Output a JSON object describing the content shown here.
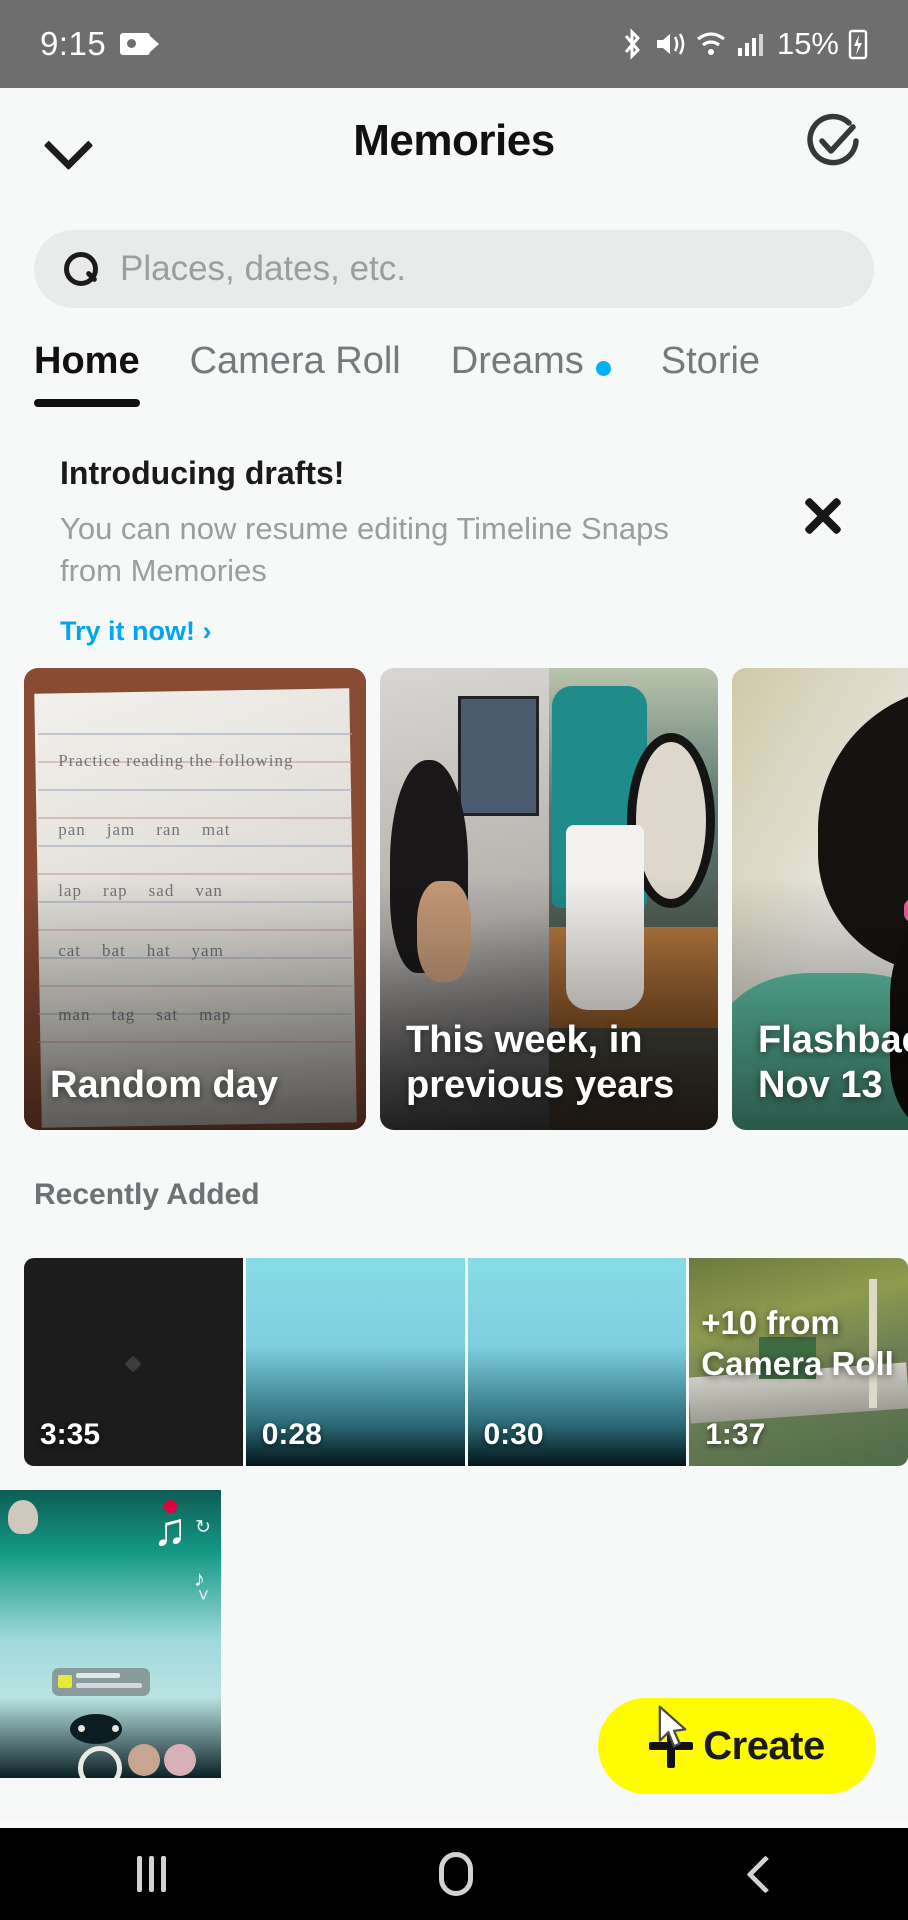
{
  "status_bar": {
    "time": "9:15",
    "recording_icon": "video-camera-icon",
    "bluetooth_icon": "bluetooth-icon",
    "mute_icon": "volume-mute-icon",
    "wifi_icon": "wifi-icon",
    "signal_icon": "cellular-signal-icon",
    "battery_percent": "15%",
    "battery_icon": "battery-charging-icon"
  },
  "header": {
    "back_icon": "chevron-down-icon",
    "title": "Memories",
    "select_icon": "circle-check-icon"
  },
  "search": {
    "icon": "search-icon",
    "placeholder": "Places, dates, etc.",
    "value": ""
  },
  "tabs": [
    {
      "label": "Home",
      "active": true,
      "dot": false
    },
    {
      "label": "Camera Roll",
      "active": false,
      "dot": false
    },
    {
      "label": "Dreams",
      "active": false,
      "dot": true
    },
    {
      "label": "Storie",
      "active": false,
      "dot": false
    }
  ],
  "banner": {
    "title": "Introducing drafts!",
    "description": "You can now resume editing Timeline Snaps from Memories",
    "cta": "Try it now!",
    "cta_arrow": "›",
    "close_icon": "close-icon"
  },
  "highlight_cards": [
    {
      "label": "Random day"
    },
    {
      "label": "This week, in previous years"
    },
    {
      "label": "Flashbac"
    },
    {
      "label": "Nov 13"
    }
  ],
  "recently_added": {
    "section_title": "Recently Added",
    "thumbnails": [
      {
        "duration": "3:35",
        "overlay": ""
      },
      {
        "duration": "0:28",
        "overlay": ""
      },
      {
        "duration": "0:30",
        "overlay": ""
      },
      {
        "duration": "1:37",
        "overlay": "+10 from Camera Roll"
      }
    ]
  },
  "create_button": {
    "label": "Create",
    "plus_icon": "plus-icon",
    "cursor_icon": "mouse-cursor-icon",
    "color": "#fffc00"
  },
  "nav_bar": {
    "recents_icon": "recents-icon",
    "home_icon": "home-icon",
    "back_icon": "back-chevron-icon"
  },
  "colors": {
    "accent_blue": "#00a5ef",
    "tab_dot": "#00b0f5",
    "snapchat_yellow": "#fffc00",
    "background": "#f7f8f8",
    "status_bar": "#6e6e6e"
  }
}
